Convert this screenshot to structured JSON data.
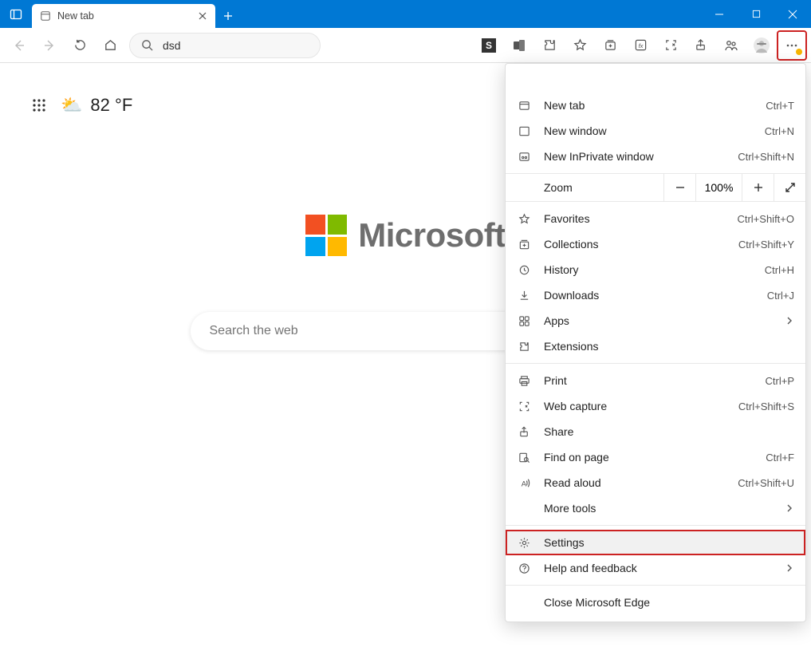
{
  "tab": {
    "title": "New tab"
  },
  "address": {
    "value": "dsd"
  },
  "ntp": {
    "brand": "Microsoft",
    "search_placeholder": "Search the web",
    "weather_temp": "82",
    "weather_unit": "°F"
  },
  "menu": {
    "new_tab": "New tab",
    "new_tab_accel": "Ctrl+T",
    "new_window": "New window",
    "new_window_accel": "Ctrl+N",
    "new_inprivate": "New InPrivate window",
    "new_inprivate_accel": "Ctrl+Shift+N",
    "zoom_label": "Zoom",
    "zoom_value": "100%",
    "favorites": "Favorites",
    "favorites_accel": "Ctrl+Shift+O",
    "collections": "Collections",
    "collections_accel": "Ctrl+Shift+Y",
    "history": "History",
    "history_accel": "Ctrl+H",
    "downloads": "Downloads",
    "downloads_accel": "Ctrl+J",
    "apps": "Apps",
    "extensions": "Extensions",
    "print": "Print",
    "print_accel": "Ctrl+P",
    "web_capture": "Web capture",
    "web_capture_accel": "Ctrl+Shift+S",
    "share": "Share",
    "find": "Find on page",
    "find_accel": "Ctrl+F",
    "read_aloud": "Read aloud",
    "read_aloud_accel": "Ctrl+Shift+U",
    "more_tools": "More tools",
    "settings": "Settings",
    "help": "Help and feedback",
    "close_edge": "Close Microsoft Edge"
  }
}
